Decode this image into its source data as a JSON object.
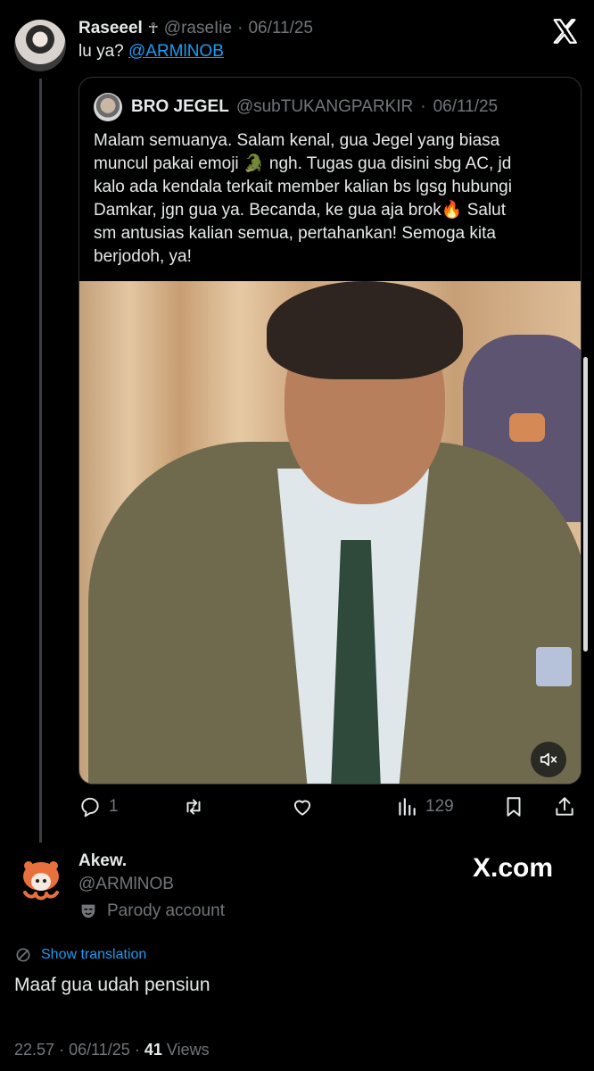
{
  "top_tweet": {
    "name": "Raseeel",
    "badge": "☥",
    "handle": "@raseIie",
    "date": "06/11/25",
    "text_prefix": "lu ya?",
    "mention": "@ARMlNOB"
  },
  "quote": {
    "name": "BRO JEGEL",
    "handle": "@subTUKANGPARKIR",
    "date": "06/11/25",
    "line1": "Malam semuanya. Salam kenal, gua Jegel yang biasa",
    "line2_pre": "muncul pakai emoji ",
    "line2_emoji": "🐊",
    "line2_post": " ngh. Tugas gua disini sbg AC, jd",
    "line3": "kalo ada kendala terkait member kalian bs lgsg hubungi",
    "line4_pre": "Damkar, jgn gua ya. Becanda, ke gua aja brok",
    "line4_emoji": "🔥",
    "line4_post": " Salut",
    "line5": "sm antusias kalian semua, pertahankan! Semoga kita",
    "line6": "berjodoh, ya!"
  },
  "actions": {
    "replies": "1",
    "views": "129"
  },
  "author": {
    "name": "Akew.",
    "handle": "@ARMlNOB",
    "label": "Parody account",
    "brand": "X.com"
  },
  "translate_label": "Show translation",
  "post_text": "Maaf gua udah pensiun",
  "footer": {
    "time": "22.57",
    "date": "06/11/25",
    "views": "41",
    "views_label": "Views"
  },
  "colors": {
    "background": "#000000",
    "text": "#e7e9ea",
    "muted": "#71767b",
    "link": "#1d9bf0",
    "border": "#2f3336"
  }
}
